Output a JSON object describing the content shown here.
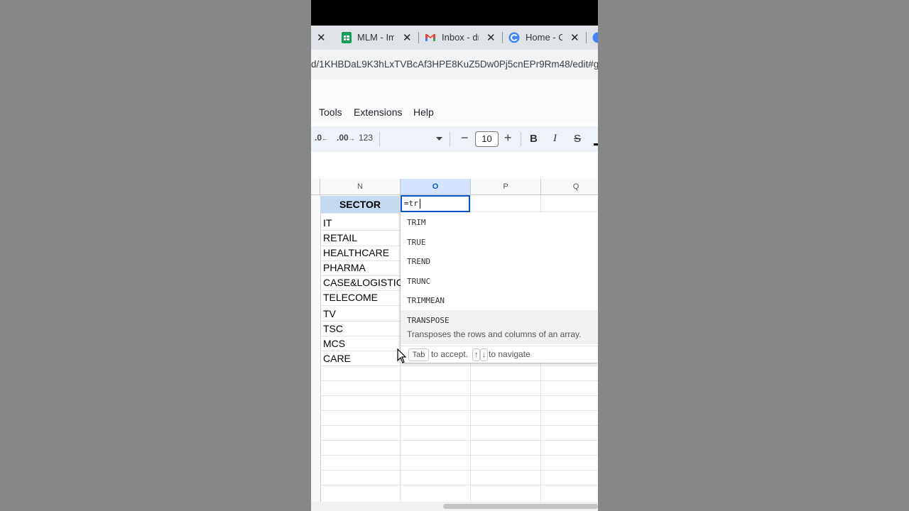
{
  "browser": {
    "tabs": [
      {
        "label": "MLM - Im",
        "favicon": "sheets-icon",
        "color": "#0f9d58"
      },
      {
        "label": "Inbox - dr",
        "favicon": "gmail-icon",
        "color": "#ea4335"
      },
      {
        "label": "Home - C",
        "favicon": "canva-icon",
        "color": "#4285f4"
      }
    ],
    "close_glyph": "✕",
    "url": "d/1KHBDaL9K3hLxTVBcAf3HPE8KuZ5Dw0Pj5cnEPr9Rm48/edit#gid"
  },
  "menu": [
    "Tools",
    "Extensions",
    "Help"
  ],
  "toolbar": {
    "decrease_decimal": ".0",
    "increase_decimal": ".00",
    "format_number": "123",
    "font_size": "10",
    "minus": "−",
    "plus": "+",
    "bold": "B",
    "italic": "I",
    "strike": "S"
  },
  "columns": [
    "N",
    "O",
    "P",
    "Q"
  ],
  "sheet": {
    "header": "SECTOR",
    "sectors": [
      "IT",
      "RETAIL",
      "HEALTHCARE",
      "PHARMA",
      "CASE&LOGISTIC",
      "TELECOME",
      "TV",
      "TSC",
      "MCS",
      "CARE"
    ],
    "active_cell_input": "=tr"
  },
  "autocomplete": {
    "items": [
      "TRIM",
      "TRUE",
      "TREND",
      "TRUNC",
      "TRIMMEAN",
      "TRANSPOSE"
    ],
    "highlighted_description": "Transposes the rows and columns of an array.",
    "footer": {
      "tab_key": "Tab",
      "accept_text": "to accept.",
      "up_key": "↑",
      "down_key": "↓",
      "navigate_text": "to navigate"
    }
  },
  "colors": {
    "selection_blue": "#0b57d0",
    "header_fill": "#c5d9f1"
  }
}
